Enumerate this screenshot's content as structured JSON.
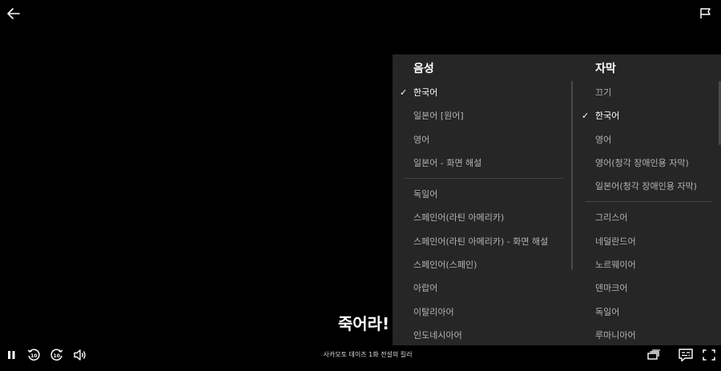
{
  "player": {
    "subtitle_line": "죽어라!",
    "episode_title": "사카모토 데이즈 1화  전설의 킬러"
  },
  "audio": {
    "title": "음성",
    "items": [
      {
        "label": "한국어",
        "selected": true
      },
      {
        "label": "일본어 [원어]",
        "selected": false
      },
      {
        "label": "영어",
        "selected": false
      },
      {
        "label": "일본어 - 화면 해설",
        "selected": false
      }
    ],
    "more_items": [
      {
        "label": "독일어"
      },
      {
        "label": "스페인어(라틴 아메리카)"
      },
      {
        "label": "스페인어(라틴 아메리카) - 화면 해설"
      },
      {
        "label": "스페인어(스페인)"
      },
      {
        "label": "아랍어"
      },
      {
        "label": "이탈리아어"
      },
      {
        "label": "인도네시아어"
      }
    ]
  },
  "subtitles": {
    "title": "자막",
    "items": [
      {
        "label": "끄기",
        "selected": false
      },
      {
        "label": "한국어",
        "selected": true
      },
      {
        "label": "영어",
        "selected": false
      },
      {
        "label": "영어(청각 장애인용 자막)",
        "selected": false
      },
      {
        "label": "일본어(청각 장애인용 자막)",
        "selected": false
      }
    ],
    "more_items": [
      {
        "label": "그리스어"
      },
      {
        "label": "네덜란드어"
      },
      {
        "label": "노르웨이어"
      },
      {
        "label": "덴마크어"
      },
      {
        "label": "독일어"
      },
      {
        "label": "루마니아어"
      }
    ]
  },
  "icons": {
    "back": "arrow-left-icon",
    "report": "flag-icon",
    "pause": "pause-icon",
    "rewind": "rewind-10-icon",
    "forward": "forward-10-icon",
    "volume": "volume-icon",
    "episodes": "episodes-icon",
    "subtitles": "subtitles-icon",
    "fullscreen": "fullscreen-icon",
    "check": "check-icon"
  },
  "rewind_seconds": "10",
  "forward_seconds": "10"
}
